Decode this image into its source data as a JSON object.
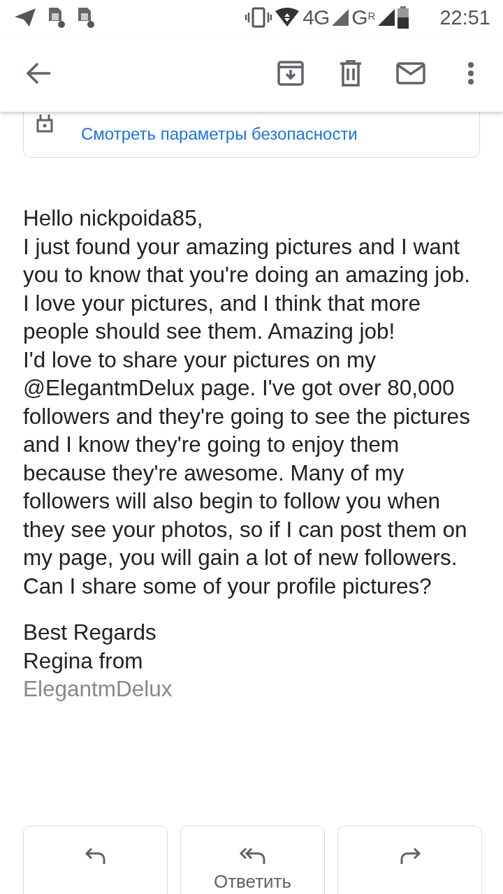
{
  "status_bar": {
    "network_label": "4G",
    "second_network_label": "G",
    "roaming_mark": "R",
    "time": "22:51"
  },
  "security_card": {
    "link": "Смотреть параметры безопасности"
  },
  "message": {
    "greeting": "Hello nickpoida85,",
    "paragraphs": [
      "I just found your amazing pictures and I want you to know that you're doing an amazing job. I love your pictures, and I think that more people should see them. Amazing job!",
      "I'd love to share your pictures on my @ElegantmDelux page. I've got over 80,000 followers and they're going to see the pictures and I know they're going to enjoy them because they're awesome. Many of my followers will also begin to follow you when they see your photos, so if I can post them on my page, you will gain a lot of new followers.",
      "Can I share some of your profile pictures?"
    ],
    "signoff": [
      "Best Regards",
      "Regina from"
    ],
    "signature": "ElegantmDelux"
  },
  "actions": [
    {
      "kind": "reply"
    },
    {
      "kind": "reply_all",
      "label": "Ответить"
    },
    {
      "kind": "forward"
    }
  ]
}
